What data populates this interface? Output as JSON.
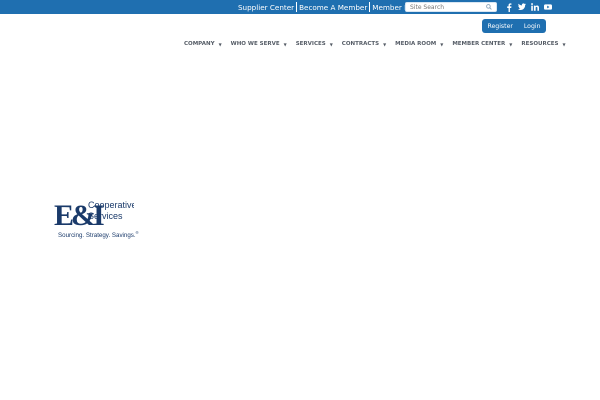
{
  "topbar": {
    "links": [
      "Supplier Center",
      "Become A Member",
      "Member Hotline"
    ],
    "search_placeholder": "Site Search"
  },
  "social": [
    "facebook-icon",
    "twitter-icon",
    "linkedin-icon",
    "youtube-icon"
  ],
  "auth": {
    "register": "Register",
    "login": "Login"
  },
  "nav": [
    "COMPANY",
    "WHO WE SERVE",
    "SERVICES",
    "CONTRACTS",
    "MEDIA ROOM",
    "MEMBER CENTER",
    "RESOURCES"
  ],
  "logo": {
    "mark": "E&I",
    "line1": "Cooperative",
    "line2": "Services",
    "tagline": "Sourcing. Strategy. Savings.",
    "tagline_mark": "®"
  },
  "colors": {
    "brand_blue": "#1f6fb0",
    "nav_text": "#555c66",
    "logo_navy": "#1a3a6a"
  }
}
